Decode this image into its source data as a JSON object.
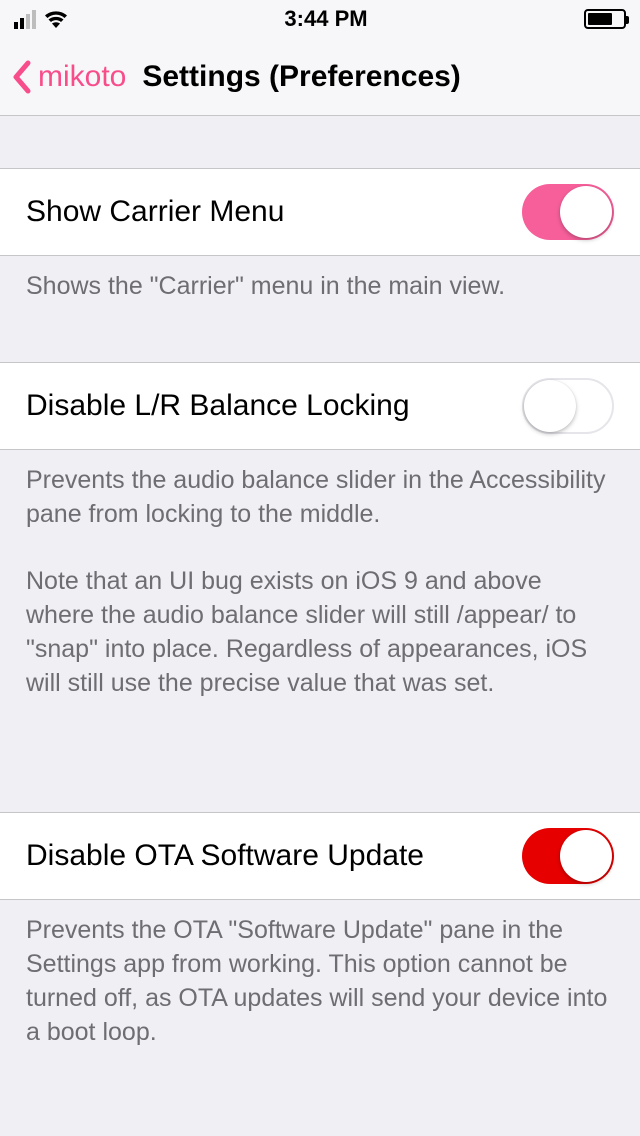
{
  "status": {
    "time": "3:44 PM"
  },
  "nav": {
    "back_label": "mikoto",
    "title": "Settings (Preferences)"
  },
  "rows": {
    "carrier": {
      "label": "Show Carrier Menu",
      "on": true,
      "color": "pink",
      "footer": "Shows the \"Carrier\" menu in the main view."
    },
    "balance": {
      "label": "Disable L/R Balance Locking",
      "on": false,
      "color": "pink",
      "footer_a": "Prevents the audio balance slider in the Accessibility pane from locking to the middle.",
      "footer_b": "Note that an UI bug exists on iOS 9 and above where the audio balance slider will still /appear/ to \"snap\" into place. Regardless of appearances, iOS will still use the precise value that was set."
    },
    "ota": {
      "label": "Disable OTA Software Update",
      "on": true,
      "color": "red",
      "footer": "Prevents the OTA \"Software Update\" pane in the Settings app from working. This option cannot be turned off, as OTA updates will send your device into a boot loop."
    }
  }
}
